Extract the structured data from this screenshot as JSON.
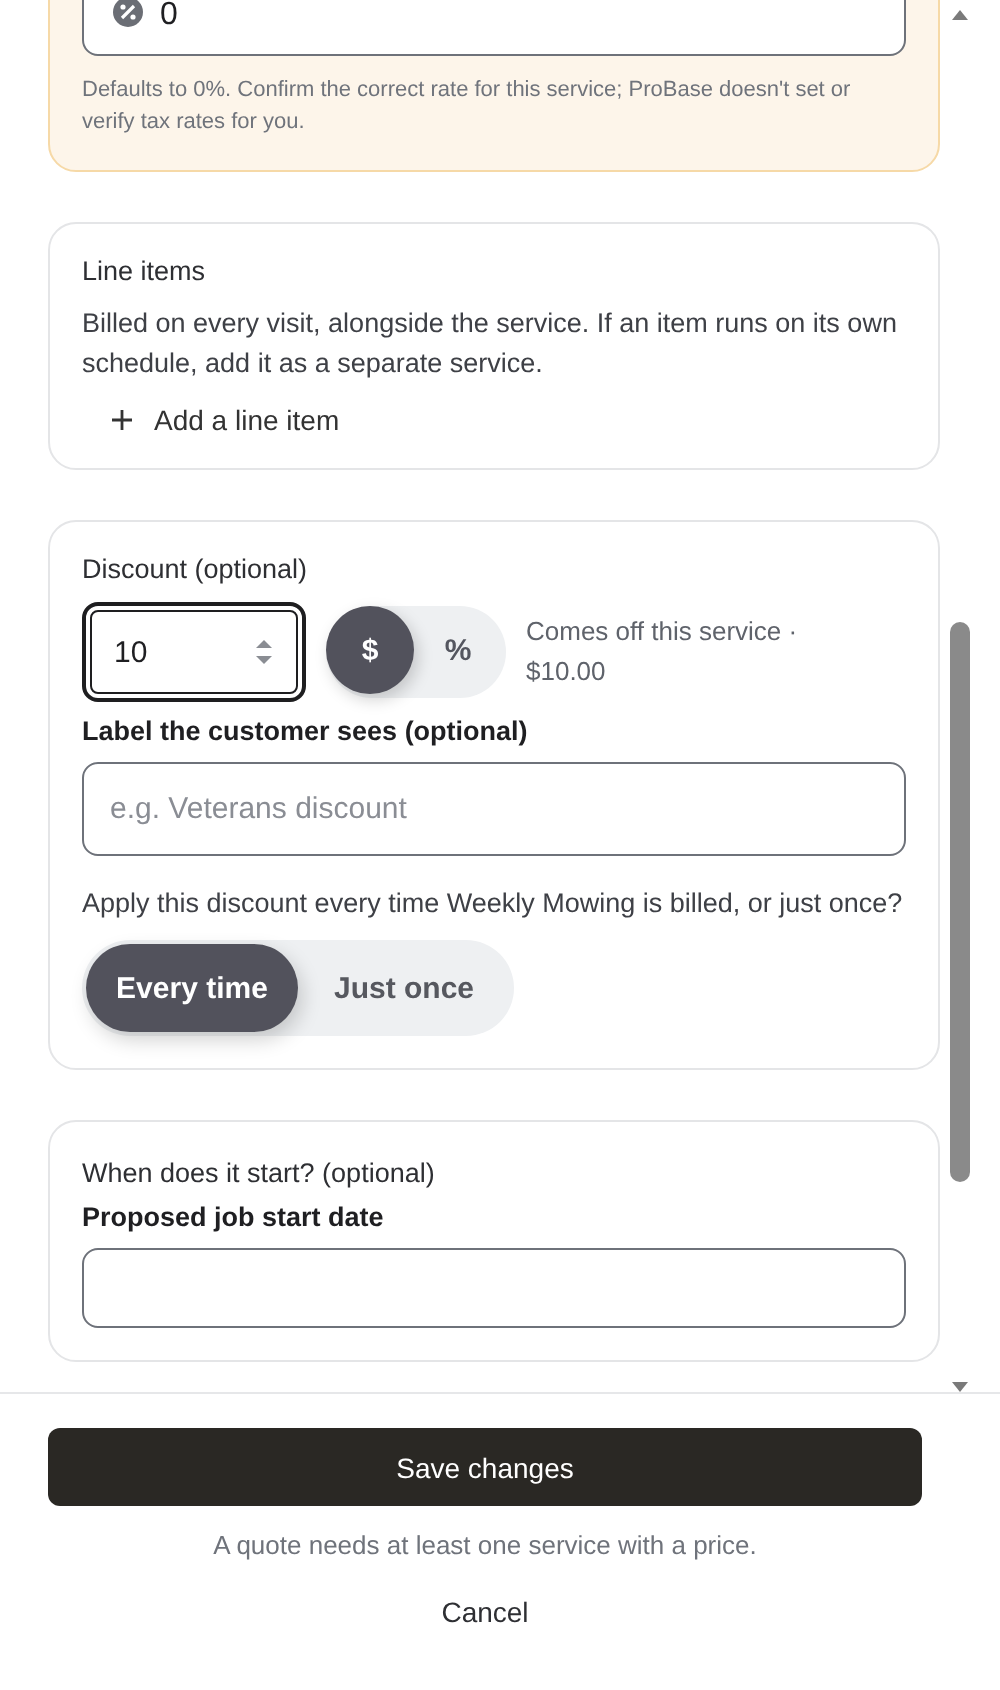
{
  "tax": {
    "value": "0",
    "hint": "Defaults to 0%. Confirm the correct rate for this service; ProBase doesn't set or verify tax rates for you."
  },
  "line_items": {
    "title": "Line items",
    "description": "Billed on every visit, alongside the service. If an item runs on its own schedule, add it as a separate service.",
    "add_label": "Add a line item"
  },
  "discount": {
    "title": "Discount (optional)",
    "amount": "10",
    "units": [
      {
        "label": "$",
        "selected": true
      },
      {
        "label": "%",
        "selected": false
      }
    ],
    "summary": "Comes off this service · $10.00",
    "label_title": "Label the customer sees (optional)",
    "label_placeholder": "e.g. Veterans discount",
    "question": "Apply this discount every time Weekly Mowing is billed, or just once?",
    "frequency": [
      {
        "label": "Every time",
        "selected": true
      },
      {
        "label": "Just once",
        "selected": false
      }
    ]
  },
  "start": {
    "title": "When does it start? (optional)",
    "field_label": "Proposed job start date"
  },
  "footer": {
    "save": "Save changes",
    "note": "A quote needs at least one service with a price.",
    "cancel": "Cancel"
  }
}
